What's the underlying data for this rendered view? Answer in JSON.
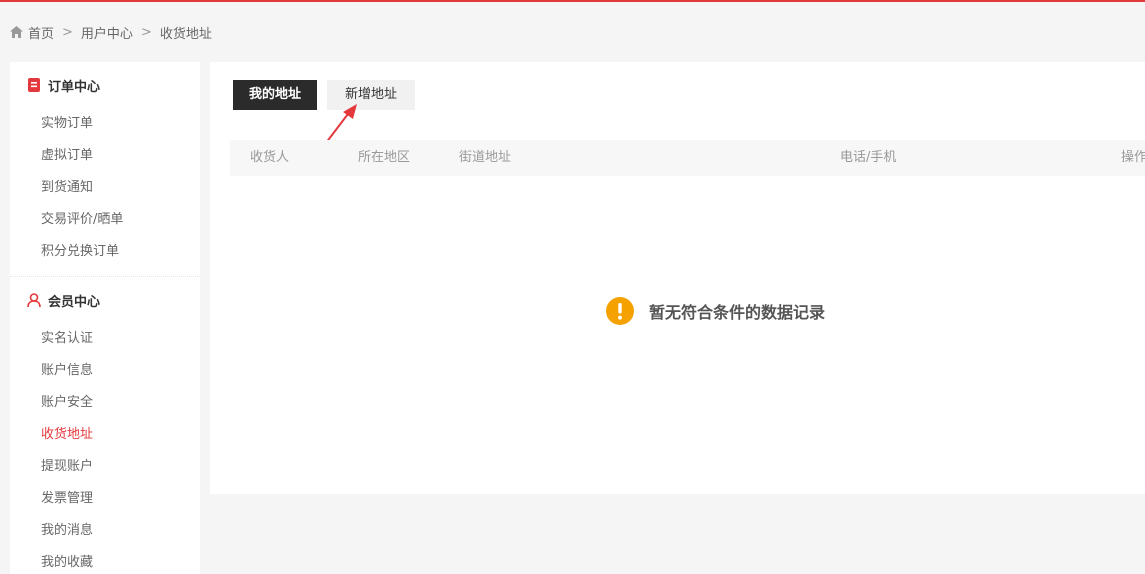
{
  "breadcrumb": {
    "home": "首页",
    "sep": ">",
    "user_center": "用户中心",
    "current": "收货地址"
  },
  "sidebar": {
    "order_center": {
      "title": "订单中心",
      "items": [
        "实物订单",
        "虚拟订单",
        "到货通知",
        "交易评价/晒单",
        "积分兑换订单"
      ]
    },
    "member_center": {
      "title": "会员中心",
      "items": [
        "实名认证",
        "账户信息",
        "账户安全",
        "收货地址",
        "提现账户",
        "发票管理",
        "我的消息",
        "我的收藏"
      ],
      "active_index": 3
    }
  },
  "tabs": {
    "my_address": "我的地址",
    "add_address": "新增地址"
  },
  "table": {
    "headers": [
      "收货人",
      "所在地区",
      "街道地址",
      "电话/手机",
      "操作"
    ]
  },
  "empty_message": "暂无符合条件的数据记录",
  "colors": {
    "accent": "#e4393c",
    "warning": "#f5a100",
    "tab_active_bg": "#2b2b2b"
  },
  "icons": {
    "home": "home-icon",
    "order_center": "order-icon",
    "member_center": "user-icon",
    "empty": "warning-icon"
  }
}
